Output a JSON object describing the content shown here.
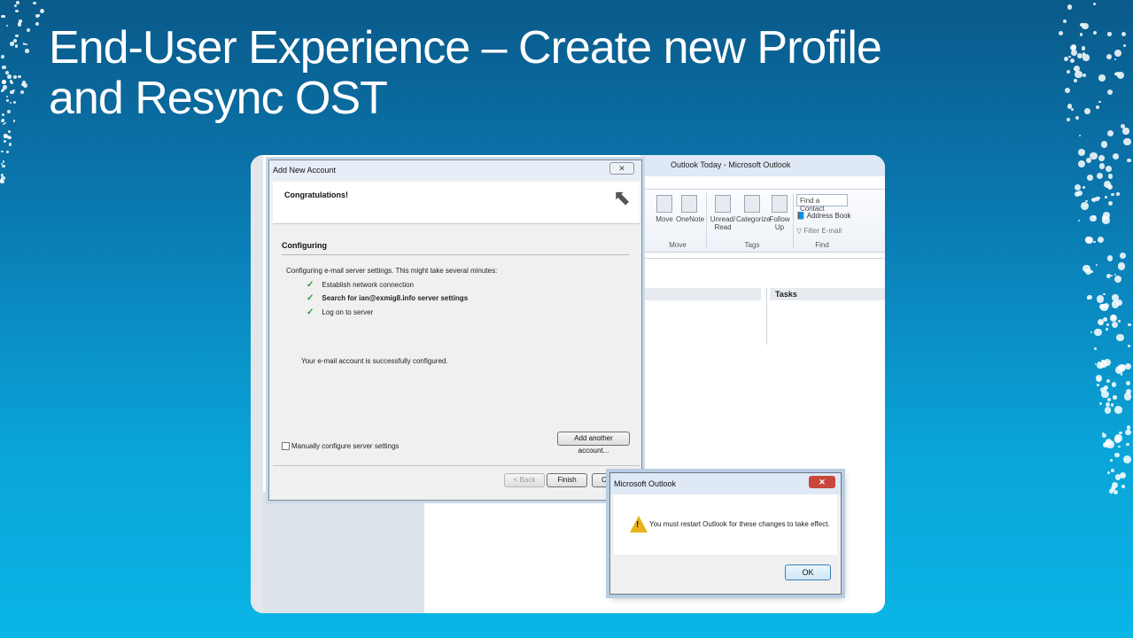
{
  "slide": {
    "title_line1": "End-User Experience – Create new Profile",
    "title_line2": "and Resync OST"
  },
  "outlook": {
    "window_title": "Outlook Today - Microsoft Outlook",
    "ribbon": {
      "move_label": "Move",
      "onenote_label": "OneNote",
      "unread_label_1": "Unread/",
      "unread_label_2": "Read",
      "categorize_label": "Categorize",
      "follow_label_1": "Follow",
      "follow_label_2": "Up",
      "find_contact_placeholder": "Find a Contact",
      "address_book_label": "Address Book",
      "filter_email_label": "Filter E-mail",
      "group_move": "Move",
      "group_tags": "Tags",
      "group_find": "Find"
    },
    "tasks_header": "Tasks"
  },
  "add_account_dialog": {
    "title": "Add New Account",
    "close_glyph": "✕",
    "header": "Congratulations!",
    "section": "Configuring",
    "intro": "Configuring e-mail server settings. This might take several minutes:",
    "steps": [
      {
        "label": "Establish network connection",
        "bold": false
      },
      {
        "label": "Search for ian@exmig8.info server settings",
        "bold": true
      },
      {
        "label": "Log on to server",
        "bold": false
      }
    ],
    "check_glyph": "✓",
    "success_text": "Your e-mail account is successfully configured.",
    "manual_config_label": "Manually configure server settings",
    "add_another_label": "Add another account...",
    "back_label": "< Back",
    "finish_label": "Finish",
    "cancel_label": "Ca"
  },
  "message_box": {
    "title": "Microsoft Outlook",
    "close_glyph": "✕",
    "icon": "warning-icon",
    "text": "You must restart Outlook for these changes to take effect.",
    "ok_label": "OK"
  }
}
